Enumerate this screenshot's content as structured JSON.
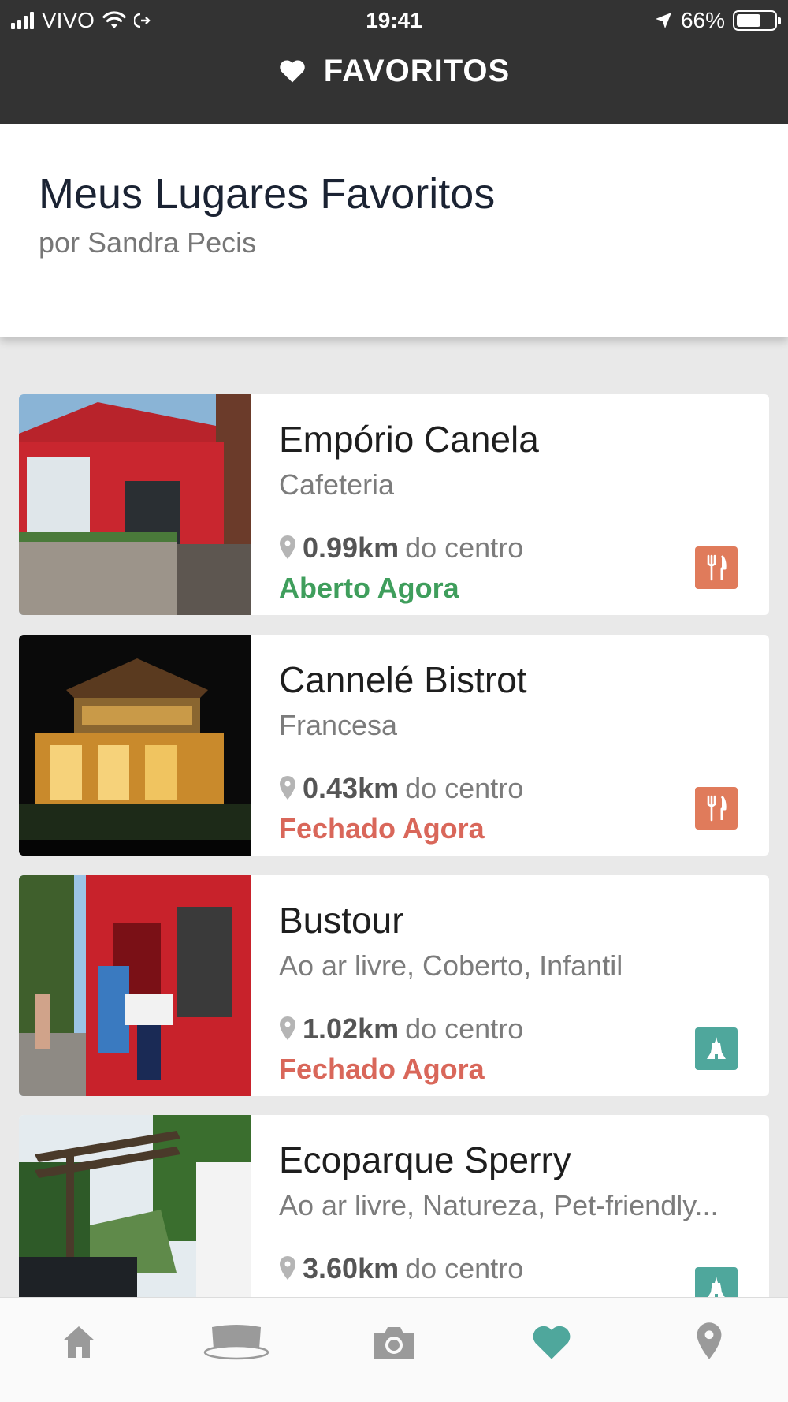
{
  "status_bar": {
    "carrier": "VIVO",
    "time": "19:41",
    "battery": "66%",
    "battery_level": 0.66
  },
  "header": {
    "icon": "heart-icon",
    "title": "FAVORITOS"
  },
  "intro": {
    "title": "Meus Lugares Favoritos",
    "subtitle": "por Sandra Pecis"
  },
  "places": [
    {
      "name": "Empório Canela",
      "category": "Cafeteria",
      "distance": "0.99km",
      "distance_suffix": "do centro",
      "status": "Aberto Agora",
      "status_color": "#3f9e5c",
      "badge_icon": "fork-knife-icon",
      "badge_color": "#e07b5b"
    },
    {
      "name": "Cannelé Bistrot",
      "category": "Francesa",
      "distance": "0.43km",
      "distance_suffix": "do centro",
      "status": "Fechado Agora",
      "status_color": "#d9675a",
      "badge_icon": "fork-knife-icon",
      "badge_color": "#e07b5b"
    },
    {
      "name": "Bustour",
      "category": "Ao ar livre, Coberto, Infantil",
      "distance": "1.02km",
      "distance_suffix": "do centro",
      "status": "Fechado Agora",
      "status_color": "#d9675a",
      "badge_icon": "landmark-icon",
      "badge_color": "#4fa79c"
    },
    {
      "name": "Ecoparque Sperry",
      "category": "Ao ar livre, Natureza, Pet-friendly...",
      "distance": "3.60km",
      "distance_suffix": "do centro",
      "status": "",
      "badge_icon": "landmark-icon",
      "badge_color": "#4fa79c"
    }
  ],
  "bottom_nav": [
    {
      "icon": "home-icon",
      "active": false
    },
    {
      "icon": "tour-map-icon",
      "active": false
    },
    {
      "icon": "camera-icon",
      "active": false
    },
    {
      "icon": "heart-icon",
      "active": true
    },
    {
      "icon": "location-pin-icon",
      "active": false
    }
  ],
  "colors": {
    "header_bg": "#333333",
    "nav_active": "#4fa79c",
    "nav_inactive": "#9a9a9a"
  }
}
